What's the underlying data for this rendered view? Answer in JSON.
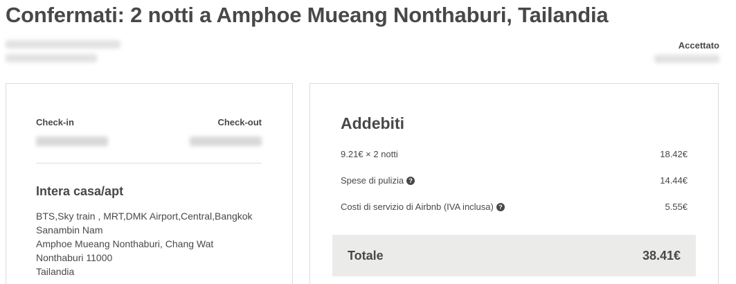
{
  "title": "Confermati: 2 notti a Amphoe Mueang Nonthaburi, Tailandia",
  "status": "Accettato",
  "stay": {
    "checkin_label": "Check-in",
    "checkout_label": "Check-out",
    "listing_type": "Intera casa/apt",
    "address_lines": [
      "BTS,Sky train , MRT,DMK Airport,Central,Bangkok",
      "Sanambin Nam",
      "Amphoe Mueang Nonthaburi, Chang Wat",
      "Nonthaburi 11000",
      "Tailandia"
    ]
  },
  "charges": {
    "title": "Addebiti",
    "items": [
      {
        "label": "9.21€ × 2 notti",
        "amount": "18.42€",
        "help_icon": false
      },
      {
        "label": "Spese di pulizia",
        "amount": "14.44€",
        "help_icon": true
      },
      {
        "label": "Costi di servizio di Airbnb (IVA inclusa)",
        "amount": "5.55€",
        "help_icon": true
      }
    ],
    "help_glyph": "?",
    "total_label": "Totale",
    "total_amount": "38.41€"
  }
}
